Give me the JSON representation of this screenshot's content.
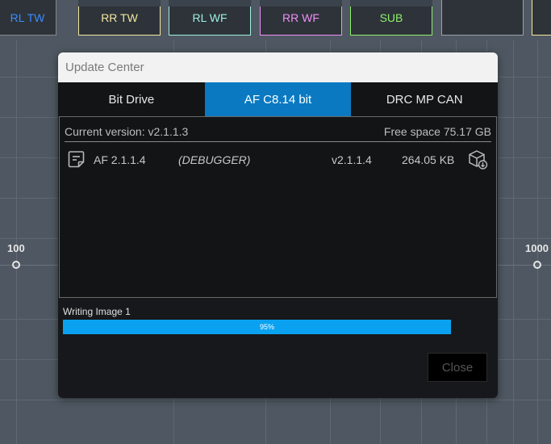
{
  "channels": [
    {
      "label": "RL TW",
      "color": "#3a8cff"
    },
    {
      "label": "RR TW",
      "color": "#f2e6a0"
    },
    {
      "label": "RL WF",
      "color": "#9ff0df"
    },
    {
      "label": "RR WF",
      "color": "#f08ff5"
    },
    {
      "label": "SUB",
      "color": "#8ef06b"
    }
  ],
  "axis": {
    "left_label": "100",
    "right_label": "1000"
  },
  "dialog": {
    "title": "Update Center",
    "tabs": [
      {
        "label": "Bit Drive",
        "active": false
      },
      {
        "label": "AF C8.14 bit",
        "active": true
      },
      {
        "label": "DRC MP CAN",
        "active": false
      }
    ],
    "current_version": "Current version: v2.1.1.3",
    "free_space": "Free space 75.17 GB",
    "files": [
      {
        "name": "AF 2.1.1.4",
        "tag": "(DEBUGGER)",
        "version": "v2.1.1.4",
        "size": "264.05 KB",
        "icon": "document-icon",
        "action_icon": "package-download-icon"
      }
    ],
    "progress": {
      "label": "Writing Image 1",
      "percent": 95,
      "text": "95%"
    },
    "close_label": "Close"
  }
}
